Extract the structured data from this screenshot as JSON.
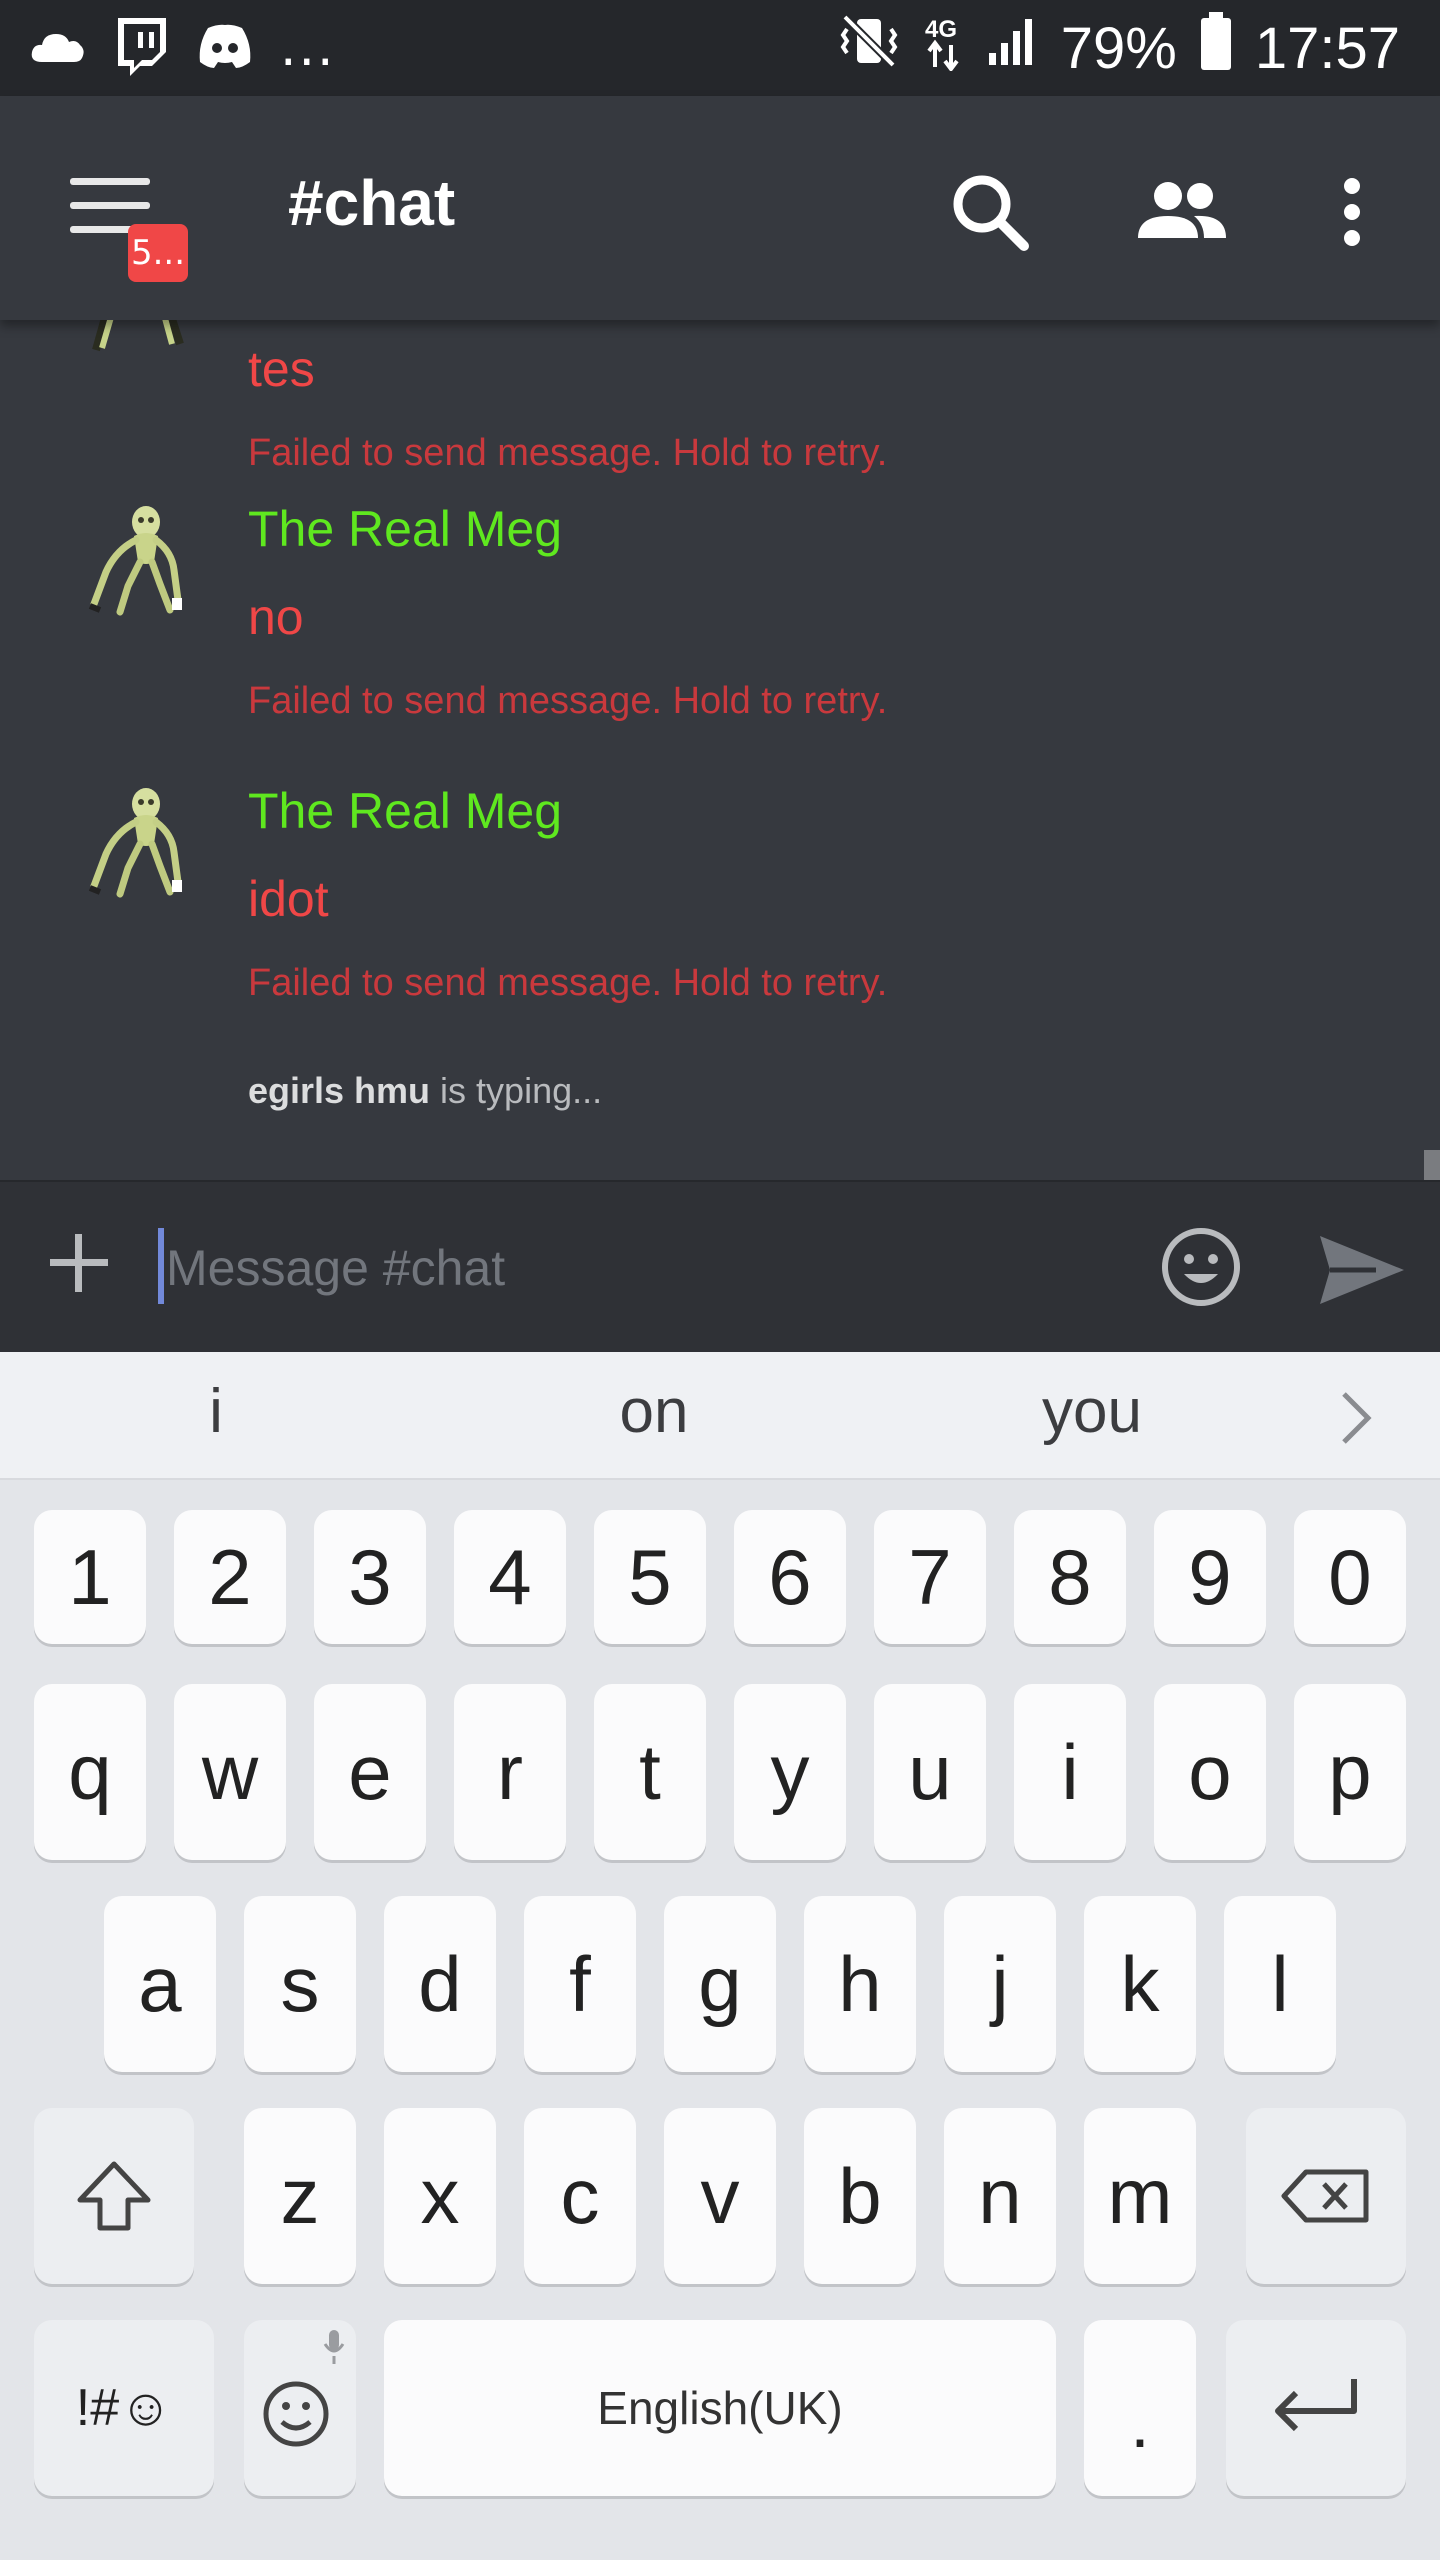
{
  "status_bar": {
    "left_icons": [
      "cloud-icon",
      "twitch-icon",
      "discord-icon"
    ],
    "overflow": "...",
    "right_icons": [
      "vibrate-mute-icon",
      "4g-icon",
      "signal-icon"
    ],
    "network": "4G",
    "battery": "79%",
    "time": "17:57"
  },
  "app_bar": {
    "menu_badge": "5...",
    "channel_title": "#chat",
    "actions": [
      "search-icon",
      "members-icon",
      "more-vert-icon"
    ]
  },
  "messages": [
    {
      "author": "",
      "text": "tes",
      "error": "Failed to send message. Hold to retry."
    },
    {
      "author": "The Real Meg",
      "text": "no",
      "error": "Failed to send message. Hold to retry."
    },
    {
      "author": "The Real Meg",
      "text": "idot",
      "error": "Failed to send message. Hold to retry."
    }
  ],
  "typing": {
    "user": "egirls hmu",
    "suffix": " is typing..."
  },
  "input": {
    "placeholder": "Message #chat",
    "value": ""
  },
  "keyboard": {
    "suggestions": [
      "i",
      "on",
      "you"
    ],
    "row_numbers": [
      "1",
      "2",
      "3",
      "4",
      "5",
      "6",
      "7",
      "8",
      "9",
      "0"
    ],
    "row_1": [
      "q",
      "w",
      "e",
      "r",
      "t",
      "y",
      "u",
      "i",
      "o",
      "p"
    ],
    "row_2": [
      "a",
      "s",
      "d",
      "f",
      "g",
      "h",
      "j",
      "k",
      "l"
    ],
    "row_3": [
      "z",
      "x",
      "c",
      "v",
      "b",
      "n",
      "m"
    ],
    "symbols_label": "!#☺",
    "space_label": "English(UK)",
    "period_label": "."
  },
  "colors": {
    "author": "#5fe81f",
    "failed_message": "#f04747",
    "error_text": "#c9393d",
    "badge": "#f04747",
    "caret": "#7289da"
  }
}
